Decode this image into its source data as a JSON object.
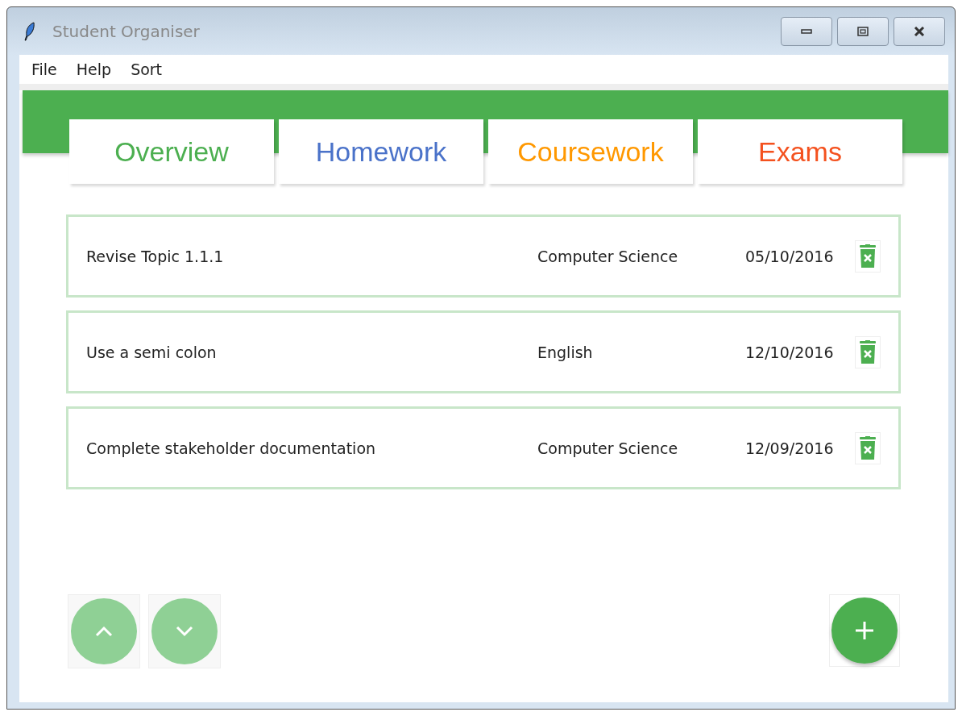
{
  "window": {
    "title": "Student Organiser"
  },
  "menu": [
    "File",
    "Help",
    "Sort"
  ],
  "tabs": [
    {
      "label": "Overview",
      "color": "#4caf50"
    },
    {
      "label": "Homework",
      "color": "#4a72c9"
    },
    {
      "label": "Coursework",
      "color": "#ff9800"
    },
    {
      "label": "Exams",
      "color": "#f4511e"
    }
  ],
  "tasks": [
    {
      "title": "Revise Topic 1.1.1",
      "subject": "Computer Science",
      "date": "05/10/2016"
    },
    {
      "title": "Use a semi colon",
      "subject": "English",
      "date": "12/10/2016"
    },
    {
      "title": "Complete stakeholder documentation",
      "subject": "Computer Science",
      "date": "12/09/2016"
    }
  ],
  "move_buttons": [
    {
      "kind": "up",
      "disabled": true
    },
    {
      "kind": "down",
      "disabled": true
    }
  ]
}
